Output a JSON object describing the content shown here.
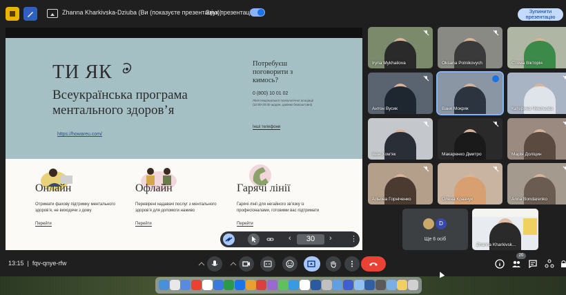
{
  "topbar": {
    "title": "Zhanna Kharkivska-Dziuba (Ви (показуєте презентацію))",
    "sound_label": "Звук презентації",
    "stop_line1": "Зупинити",
    "stop_line2": "презентацію"
  },
  "slide": {
    "heading": "ТИ ЯК",
    "subtitle": "Всеукраїнська програма ментального здоров’я",
    "link": "https://howareu.com/",
    "question": "Потребуєш поговорити з кимось?",
    "phone": "0 (800) 10 01 02",
    "line_note": "Лінія Національної психологічної асоціації (10:00-20:00 щодня, дзвінки безкоштовні)",
    "other_phones": "Інші телефони",
    "columns": [
      {
        "title": "Онлайн",
        "text": "Отримати фахову підтримку ментального здоров’я, не виходячи з дому",
        "link": "Перейти"
      },
      {
        "title": "Офлайн",
        "text": "Перевірені надавачі послуг з ментального здоров’я для допомоги наживо",
        "link": "Перейти"
      },
      {
        "title": "Гарячі лінії",
        "text": "Гарячі лінії для негайного зв’язку із професіоналами, готовими вас підтримати",
        "link": "Перейти"
      }
    ]
  },
  "slide_controls": {
    "page": "30"
  },
  "participants": [
    {
      "name": "Iryna Mykhailova",
      "muted": true,
      "bg": "#7a8a6a",
      "shirt": "#2a2a2a"
    },
    {
      "name": "Oksana Polnikovych",
      "muted": true,
      "bg": "#8a8a84",
      "shirt": "#3a3a3a"
    },
    {
      "name": "Стома Вікторія",
      "muted": false,
      "bg": "#b0b6a4",
      "shirt": "#3c8a4a"
    },
    {
      "name": "Антон Вусик",
      "muted": true,
      "bg": "#5a6470",
      "shirt": "#1e2630"
    },
    {
      "name": "Ваня Мокряк",
      "muted": false,
      "bg": "#8a96a4",
      "shirt": "#2c3440"
    },
    {
      "name": "Катерина Чмельова",
      "muted": true,
      "bg": "#a8b4c4",
      "shirt": "#dfe4ea"
    },
    {
      "name": "Іван Хом’як",
      "muted": true,
      "bg": "#c4c8cc",
      "shirt": "#2a2e36"
    },
    {
      "name": "Макаренко Дмитро",
      "muted": true,
      "bg": "#2a2a2a",
      "shirt": "#1a1a1a"
    },
    {
      "name": "Марія Доліцин",
      "muted": true,
      "bg": "#9a8a80",
      "shirt": "#5a4a40"
    },
    {
      "name": "Альона Горніченко",
      "muted": true,
      "bg": "#b4a08a",
      "shirt": "#4a3a30"
    },
    {
      "name": "Олена Кравчук",
      "muted": true,
      "bg": "#c8b4a0",
      "shirt": "#d8a070"
    },
    {
      "name": "Anna Bondarenko",
      "muted": true,
      "bg": "#a49a8e",
      "shirt": "#6a5c50"
    }
  ],
  "others_tile": {
    "label": "Ще 6 осіб",
    "avatar_letter": "D"
  },
  "self_tile": {
    "name": "Zhanna Kharkivsk..."
  },
  "bottombar": {
    "time": "13:15",
    "meeting_code": "fqv-qnye-rfw",
    "participant_count": "20"
  },
  "colors": {
    "accent": "#1a73e8",
    "end_call": "#ea4335",
    "slide_top": "#a4c0c4"
  }
}
